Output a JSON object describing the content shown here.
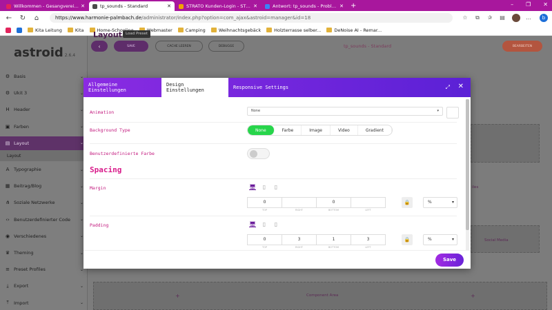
{
  "browser": {
    "tabs": [
      {
        "label": "Willkommen - Gesangverein Har",
        "color": "#e2245c",
        "active": false
      },
      {
        "label": "tp_sounds - Standard",
        "color": "#4a4a4a",
        "active": true
      },
      {
        "label": "STRATO Kunden-Login - STRATO",
        "color": "#f2a200",
        "active": false
      },
      {
        "label": "Antwort: tp_sounds - Probleme",
        "color": "#3b82f6",
        "active": false
      }
    ],
    "new_tab": "+",
    "window_controls": [
      "–",
      "❐",
      "✕"
    ],
    "url_host": "https://www.harmonie-palmbach.de",
    "url_path": "/administrator/index.php?option=com_ajax&astroid=manager&id=18",
    "bookmarks": [
      "Kita Leitung",
      "Kita",
      "Home-Schooling",
      "Webmaster",
      "Camping",
      "Weihnachtsgebäck",
      "Holzterrasse selber...",
      "DeNoise AI - Remar..."
    ]
  },
  "app": {
    "logo": "astroid",
    "version": "2.6.4",
    "top_buttons": [
      "SAVE",
      "CACHE LEEREN",
      "DEBUGGE"
    ],
    "top_title": "tp_sounds - Standard",
    "top_right_button": "BEARBEITEN",
    "sidebar": [
      {
        "label": "Basis",
        "icon": "⚙"
      },
      {
        "label": "Ukit 3",
        "icon": "⚙"
      },
      {
        "label": "Header",
        "icon": "H"
      },
      {
        "label": "Farben",
        "icon": "▣"
      },
      {
        "label": "Layout",
        "icon": "▤",
        "active": true
      },
      {
        "label": "Typographie",
        "icon": "A"
      },
      {
        "label": "Beitrag/Blog",
        "icon": "▦"
      },
      {
        "label": "Soziale Netzwerke",
        "icon": "⋔"
      },
      {
        "label": "Benutzerdefinierter Code",
        "icon": "‹›"
      },
      {
        "label": "Verschiedenes",
        "icon": "◉"
      },
      {
        "label": "Theming",
        "icon": "♛"
      },
      {
        "label": "Preset Profiles",
        "icon": "≡"
      },
      {
        "label": "Export",
        "icon": "⤓"
      },
      {
        "label": "Import",
        "icon": "⤒"
      }
    ],
    "sidebar_sub": "Layout",
    "page_title": "Layout",
    "load_preset": "Load Preset",
    "bg_component_area": "Component Area",
    "bg_social": "Social Media",
    "bg_plus": "+",
    "bg_styles": "iles"
  },
  "modal": {
    "tabs": [
      "Allgemeine Einstellungen",
      "Design Einstellungen",
      "Responsive Settings"
    ],
    "active_tab": 1,
    "expand_icon": "⤢",
    "close": "✕",
    "animation_label": "Animation",
    "animation_value": "None",
    "background_type_label": "Background Type",
    "background_options": [
      "None",
      "Farbe",
      "Image",
      "Video",
      "Gradient"
    ],
    "background_selected": 0,
    "custom_color_label": "Benutzerdefinierte Farbe",
    "spacing_heading": "Spacing",
    "margin_label": "Margin",
    "margin_values": [
      "0",
      "",
      "0",
      ""
    ],
    "padding_label": "Padding",
    "padding_values": [
      "0",
      "3",
      "1",
      "3"
    ],
    "side_labels": [
      "TOP",
      "RIGHT",
      "BOTTOM",
      "LEFT"
    ],
    "unit": "%",
    "save": "Save"
  }
}
